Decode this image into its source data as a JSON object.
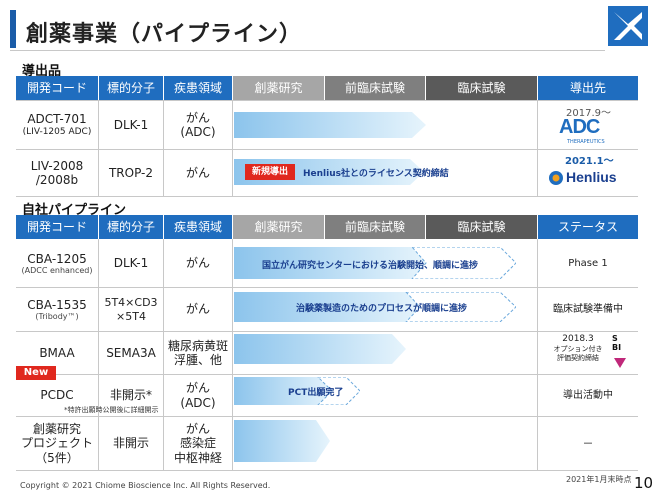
{
  "title": "創薬事業（パイプライン）",
  "colors": {
    "accent": "#1f6dbf",
    "new_badge": "#e0281e",
    "bar": "#bfe0f7"
  },
  "out_licensed": {
    "section_label": "導出品",
    "headers": [
      "開発コード",
      "標的分子",
      "疾患領域",
      "創薬研究",
      "前臨床試験",
      "臨床試験",
      "導出先"
    ],
    "rows": [
      {
        "code": "ADCT-701",
        "code_sub": "(LIV-1205 ADC)",
        "target": "DLK-1",
        "disease": "がん",
        "disease_sub": "(ADC)",
        "partner_date": "2017.9～",
        "partner_name": "ADC",
        "partner_sub": "THERAPEUTICS"
      },
      {
        "code": "LIV-2008",
        "code_sub": "/2008b",
        "target": "TROP-2",
        "disease": "がん",
        "disease_sub": "",
        "badge": "新規導出",
        "bar_text": "Henlius社とのライセンス契約締結",
        "partner_date": "2021.1～",
        "partner_name": "Henlius"
      }
    ]
  },
  "in_house": {
    "section_label": "自社パイプライン",
    "headers": [
      "開発コード",
      "標的分子",
      "疾患領域",
      "創薬研究",
      "前臨床試験",
      "臨床試験",
      "ステータス"
    ],
    "rows": [
      {
        "code": "CBA-1205",
        "code_sub": "(ADCC enhanced)",
        "target": "DLK-1",
        "disease": "がん",
        "disease_sub": "",
        "bar_text": "国立がん研究センターにおける治験開始、順調に進捗",
        "status": "Phase 1"
      },
      {
        "code": "CBA-1535",
        "code_sub": "(Tribody™)",
        "target": "5T4×CD3",
        "target_sub": "×5T4",
        "disease": "がん",
        "disease_sub": "",
        "bar_text": "治験薬製造のためのプロセスが順調に進捗",
        "status": "臨床試験準備中"
      },
      {
        "code": "BMAA",
        "code_sub": "",
        "target": "SEMA3A",
        "disease": "糖尿病黄斑",
        "disease_sub": "浮腫、他",
        "status_line1": "2018.3",
        "status_line2": "オプション付き",
        "status_line3": "評価契約締結",
        "status_logo": "SBI"
      },
      {
        "code": "PCDC",
        "code_sub": "",
        "new_label": "New",
        "target": "非開示*",
        "disease": "がん",
        "disease_sub": "(ADC)",
        "bar_text": "PCT出願完了",
        "status": "導出活動中",
        "note": "*特許出願時公開後に詳細開示"
      },
      {
        "code": "創薬研究",
        "code_sub": "プロジェクト",
        "code_sub2": "（5件）",
        "target": "非開示",
        "disease": "がん",
        "disease_sub": "感染症",
        "disease_sub2": "中枢神経",
        "status": "－"
      }
    ]
  },
  "footer": {
    "copyright": "Copyright © 2021 Chiome Bioscience Inc. All Rights Reserved.",
    "as_of": "2021年1月末時点",
    "page": "10"
  }
}
